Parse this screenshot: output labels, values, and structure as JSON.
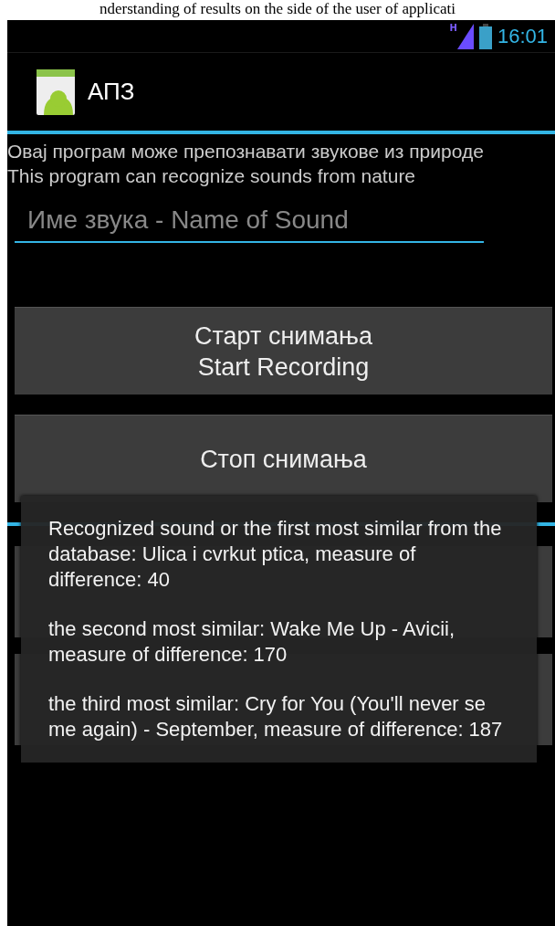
{
  "caption": "nderstanding of results on the side of the user of applicati",
  "status_bar": {
    "network": "H",
    "time": "16:01"
  },
  "action_bar": {
    "title": "АПЗ"
  },
  "description": [
    "Овај програм може препознавати звукове из природе",
    "This program can recognize sounds from nature"
  ],
  "sound_name_field": {
    "placeholder": "Име звука - Name of Sound"
  },
  "recording_buttons": [
    {
      "lines": [
        "Старт снимања",
        "Start Recording"
      ]
    },
    {
      "lines": [
        "Стоп снимања"
      ]
    }
  ],
  "lower_buttons": [
    {
      "kind": "covered"
    },
    {
      "kind": "covered"
    }
  ],
  "toast": {
    "messages": [
      "Recognized sound or the first most similar from the database: Ulica i cvrkut ptica, measure of difference: 40",
      "the second most similar: Wake Me Up - Avicii, measure of difference: 170",
      "the third most similar:  Cry for You (You'll never se me again) - September, measure of difference: 187"
    ]
  }
}
